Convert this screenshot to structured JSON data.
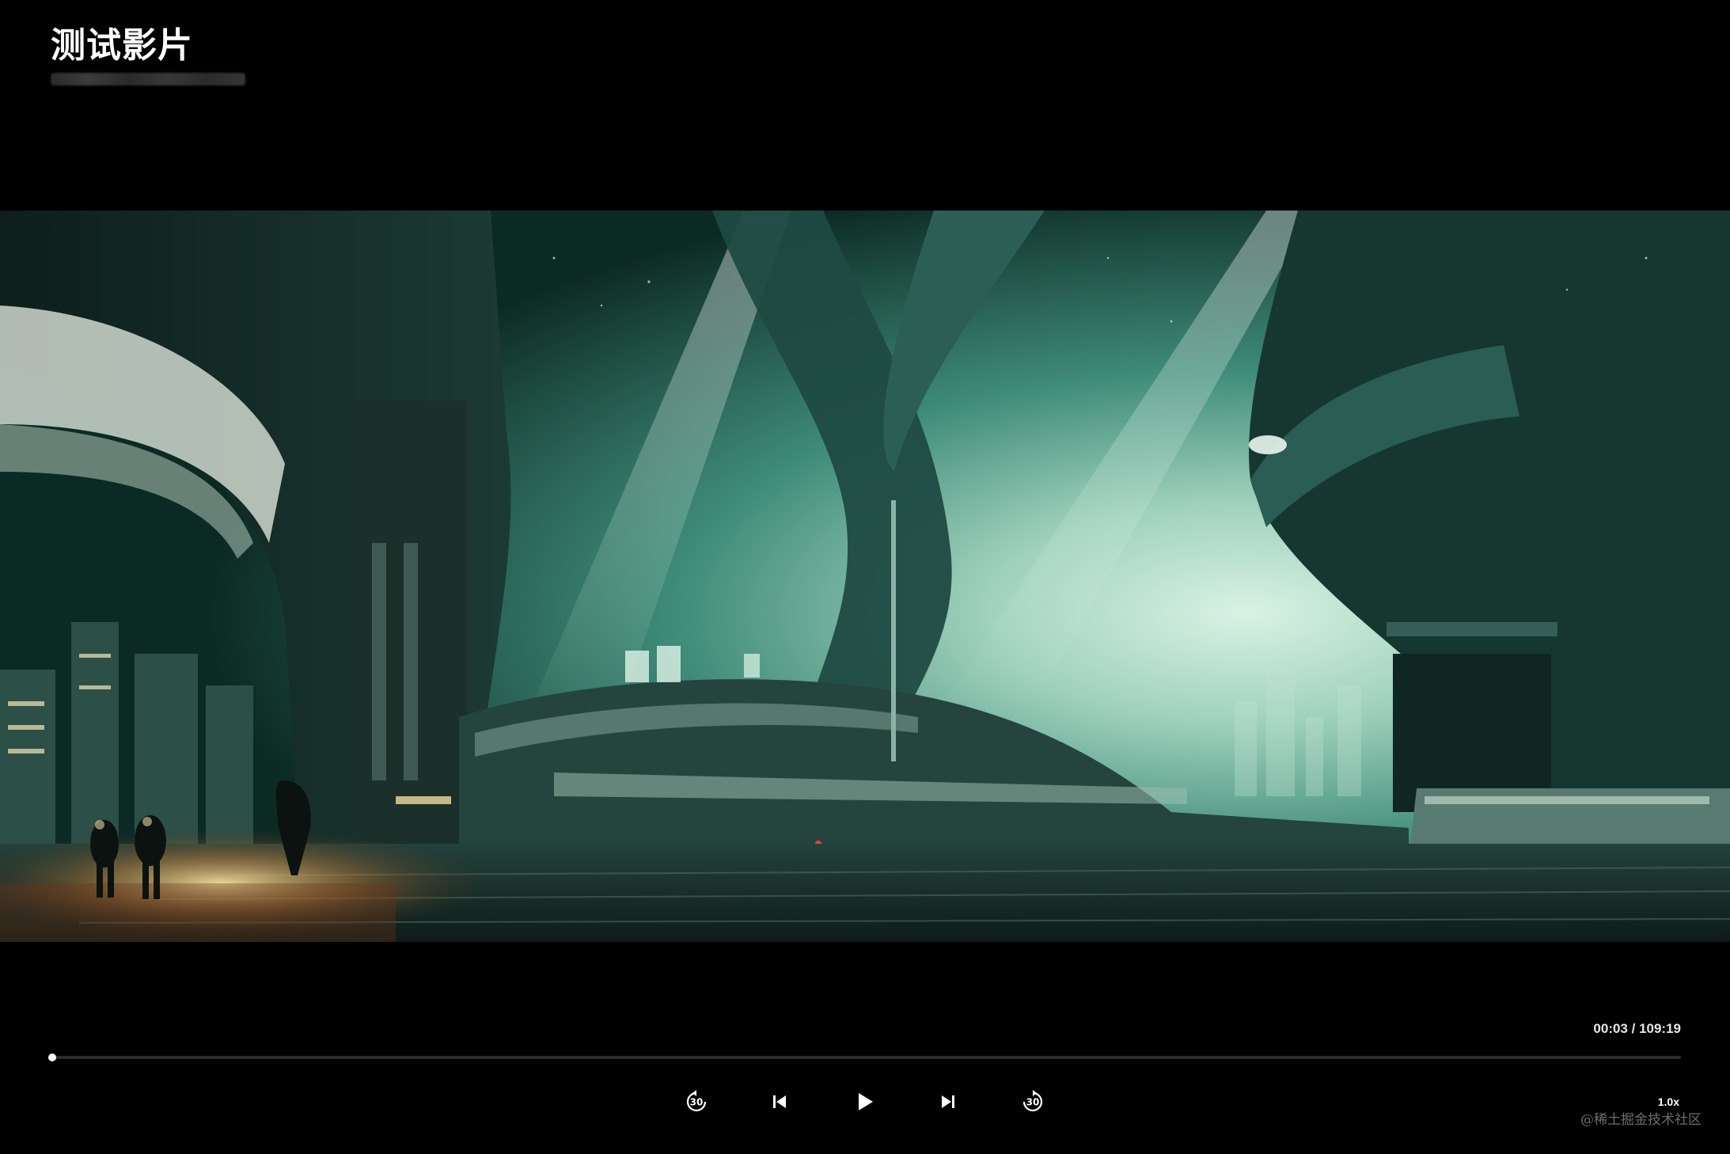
{
  "header": {
    "title": "测试影片"
  },
  "playback": {
    "current_time": "00:03",
    "separator": " / ",
    "duration": "109:19",
    "progress_fraction": 0.002,
    "speed_label": "1.0x",
    "rewind_seconds": "30",
    "forward_seconds": "30"
  },
  "controls": {
    "rewind_icon": "rewind-30-icon",
    "previous_icon": "skip-previous-icon",
    "play_icon": "play-icon",
    "next_icon": "skip-next-icon",
    "forward_icon": "forward-30-icon"
  },
  "watermark": {
    "text": "@稀土掘金技术社区"
  },
  "colors": {
    "background": "#000000",
    "accent": "#ffffff",
    "track": "#2b2b2b",
    "scene_teal": "#2e7a68"
  }
}
